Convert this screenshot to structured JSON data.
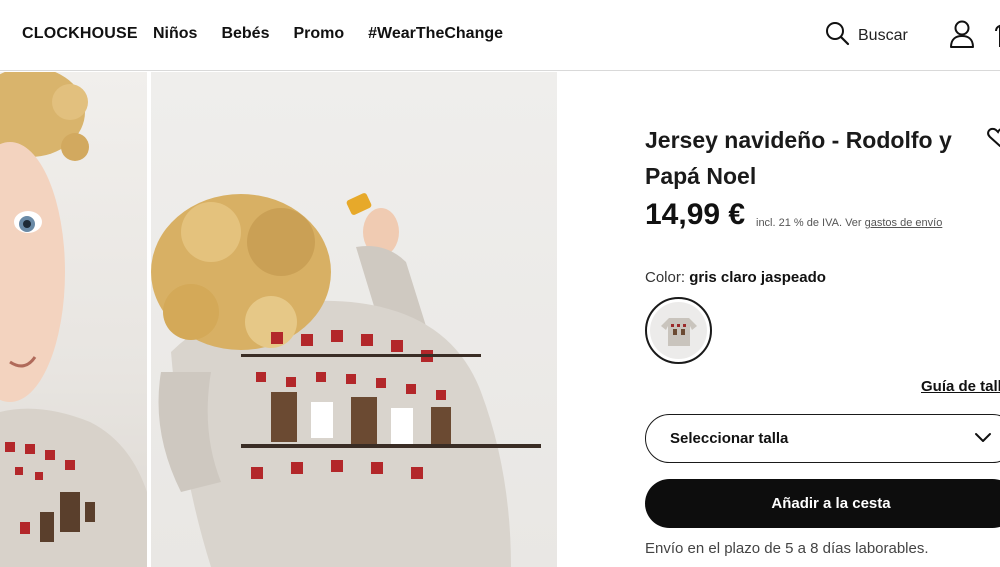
{
  "header": {
    "brand": "CLOCKHOUSE",
    "nav": [
      "Niños",
      "Bebés",
      "Promo",
      "#WearTheChange"
    ],
    "search_label": "Buscar"
  },
  "product": {
    "title": "Jersey navideño - Rodolfo y Papá Noel",
    "price": "14,99 €",
    "tax_note": "incl. 21 % de IVA. Ver",
    "shipping_link": "gastos de envío",
    "color_label": "Color:",
    "color_value": "gris claro jaspeado",
    "size_guide": "Guía de tall",
    "size_select": "Seleccionar talla",
    "add_to_cart": "Añadir a la cesta",
    "shipping_note": "Envío en el plazo de 5 a 8 días laborables."
  },
  "icons": {
    "search": "search-icon",
    "account": "user-icon",
    "wishlist": "heart-icon",
    "chevron": "chevron-down-icon"
  },
  "colors": {
    "text": "#1a1a1a",
    "button_bg": "#0d0d0d",
    "border": "#d9d9d9"
  }
}
